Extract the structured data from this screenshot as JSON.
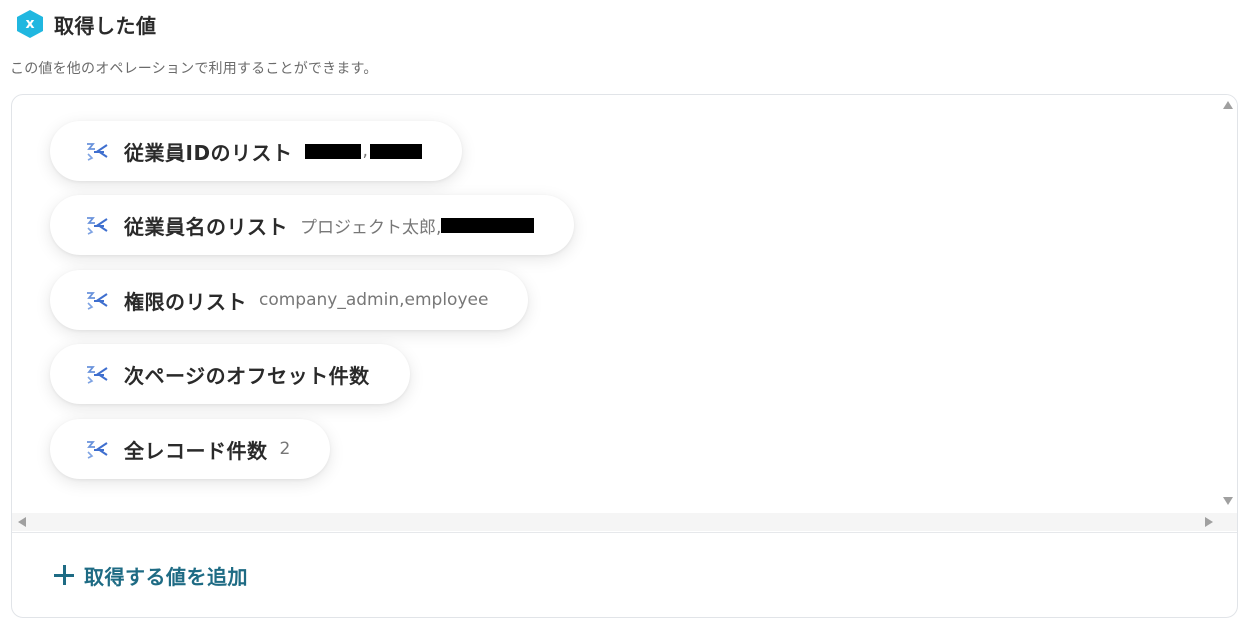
{
  "header": {
    "badge_letter": "x",
    "title": "取得した値",
    "badge_color": "#20b7e0"
  },
  "subtitle": "この値を他のオペレーションで利用することができます。",
  "items": [
    {
      "label": "従業員IDのリスト",
      "value_parts": [
        "[redacted]",
        ",",
        "[redacted]"
      ]
    },
    {
      "label": "従業員名のリスト",
      "value_parts": [
        "プロジェクト太郎,",
        "[redacted]"
      ]
    },
    {
      "label": "権限のリスト",
      "value": "company_admin,employee"
    },
    {
      "label": "次ページのオフセット件数",
      "value": ""
    },
    {
      "label": "全レコード件数",
      "value": "2"
    }
  ],
  "add_button": {
    "label": "取得する値を追加",
    "icon": "plus-icon",
    "color": "#1e6b84"
  },
  "icons": {
    "item_icon": "extract-arrows-icon",
    "icon_color": "#5b8cd9"
  }
}
